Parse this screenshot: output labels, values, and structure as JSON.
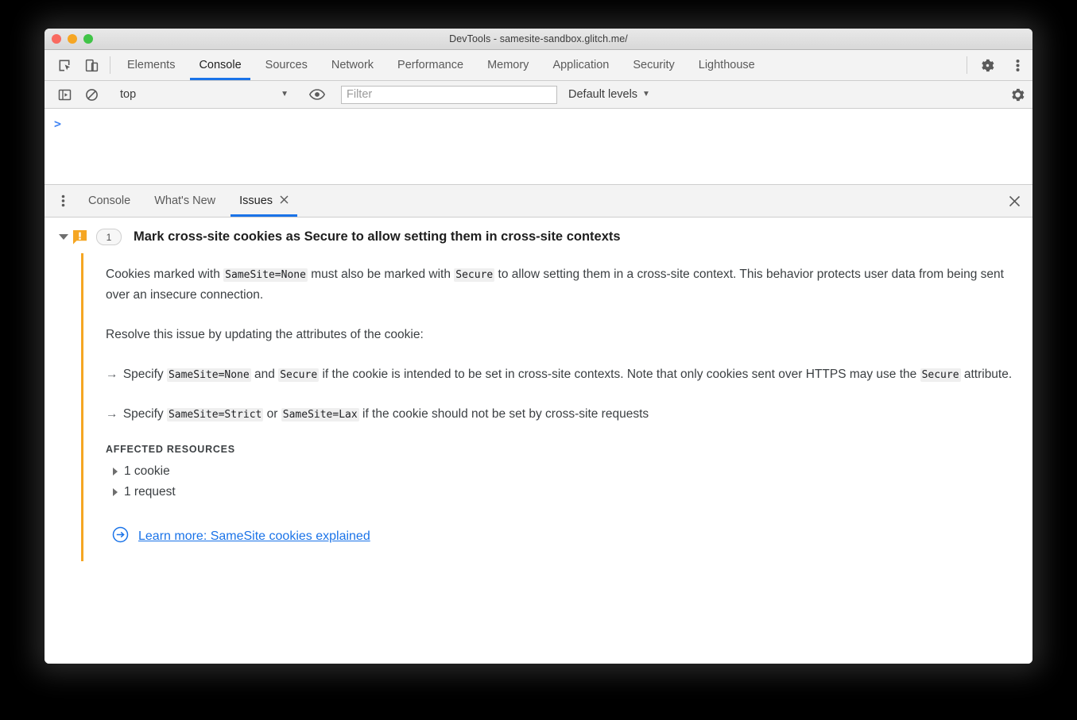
{
  "window": {
    "title": "DevTools - samesite-sandbox.glitch.me/",
    "traffic_lights": [
      "close",
      "minimize",
      "maximize"
    ],
    "colors": {
      "accent_blue": "#1a73e8",
      "issue_orange": "#f5a623",
      "link_blue": "#1a73e8",
      "chrome_gray": "#f3f3f3"
    }
  },
  "main_toolbar": {
    "icons": [
      {
        "name": "inspect-element-icon",
        "title": "Inspect element"
      },
      {
        "name": "device-toolbar-icon",
        "title": "Toggle device toolbar"
      }
    ],
    "tabs": [
      {
        "label": "Elements",
        "active": false
      },
      {
        "label": "Console",
        "active": true
      },
      {
        "label": "Sources",
        "active": false
      },
      {
        "label": "Network",
        "active": false
      },
      {
        "label": "Performance",
        "active": false
      },
      {
        "label": "Memory",
        "active": false
      },
      {
        "label": "Application",
        "active": false
      },
      {
        "label": "Security",
        "active": false
      },
      {
        "label": "Lighthouse",
        "active": false
      }
    ],
    "right_icons": [
      {
        "name": "settings-gear-icon",
        "title": "Settings"
      },
      {
        "name": "more-options-icon",
        "title": "Customize and control DevTools"
      }
    ]
  },
  "console_toolbar": {
    "sidebar_toggle_title": "Show console sidebar",
    "clear_console_title": "Clear console",
    "context_value": "top",
    "eye_icon_title": "Create live expression",
    "filter_placeholder": "Filter",
    "filter_value": "",
    "levels_label": "Default levels",
    "settings_title": "Console settings"
  },
  "console_output": {
    "prompt": ">"
  },
  "drawer": {
    "menu_title": "More tools",
    "tabs": [
      {
        "label": "Console",
        "active": false,
        "closable": false
      },
      {
        "label": "What's New",
        "active": false,
        "closable": false
      },
      {
        "label": "Issues",
        "active": true,
        "closable": true
      }
    ],
    "close_label": "×"
  },
  "issue": {
    "expanded": true,
    "severity": "warning",
    "count": "1",
    "title": "Mark cross-site cookies as Secure to allow setting them in cross-site contexts",
    "paragraphs": [
      {
        "id": "description",
        "parts": [
          {
            "type": "text",
            "value": "Cookies marked with "
          },
          {
            "type": "code",
            "value": "SameSite=None"
          },
          {
            "type": "text",
            "value": " must also be marked with "
          },
          {
            "type": "code",
            "value": "Secure"
          },
          {
            "type": "text",
            "value": " to allow setting them in a cross-site context. This behavior protects user data from being sent over an insecure connection."
          }
        ]
      },
      {
        "id": "resolve-intro",
        "parts": [
          {
            "type": "text",
            "value": "Resolve this issue by updating the attributes of the cookie:"
          }
        ]
      },
      {
        "id": "bullet-1",
        "parts": [
          {
            "type": "arrow",
            "value": "→ "
          },
          {
            "type": "text",
            "value": "Specify "
          },
          {
            "type": "code",
            "value": "SameSite=None"
          },
          {
            "type": "text",
            "value": " and "
          },
          {
            "type": "code",
            "value": "Secure"
          },
          {
            "type": "text",
            "value": " if the cookie is intended to be set in cross-site contexts. Note that only cookies sent over HTTPS may use the "
          },
          {
            "type": "code",
            "value": "Secure"
          },
          {
            "type": "text",
            "value": " attribute."
          }
        ]
      },
      {
        "id": "bullet-2",
        "parts": [
          {
            "type": "arrow",
            "value": "→ "
          },
          {
            "type": "text",
            "value": "Specify "
          },
          {
            "type": "code",
            "value": "SameSite=Strict"
          },
          {
            "type": "text",
            "value": " or "
          },
          {
            "type": "code",
            "value": "SameSite=Lax"
          },
          {
            "type": "text",
            "value": " if the cookie should not be set by cross-site requests"
          }
        ]
      }
    ],
    "affected_resources_label": "AFFECTED RESOURCES",
    "affected_resources": [
      {
        "label": "1 cookie",
        "expanded": false
      },
      {
        "label": "1 request",
        "expanded": false
      }
    ],
    "learn_more": {
      "icon": "external-link-circle-arrow-icon",
      "label": "Learn more: SameSite cookies explained"
    }
  }
}
